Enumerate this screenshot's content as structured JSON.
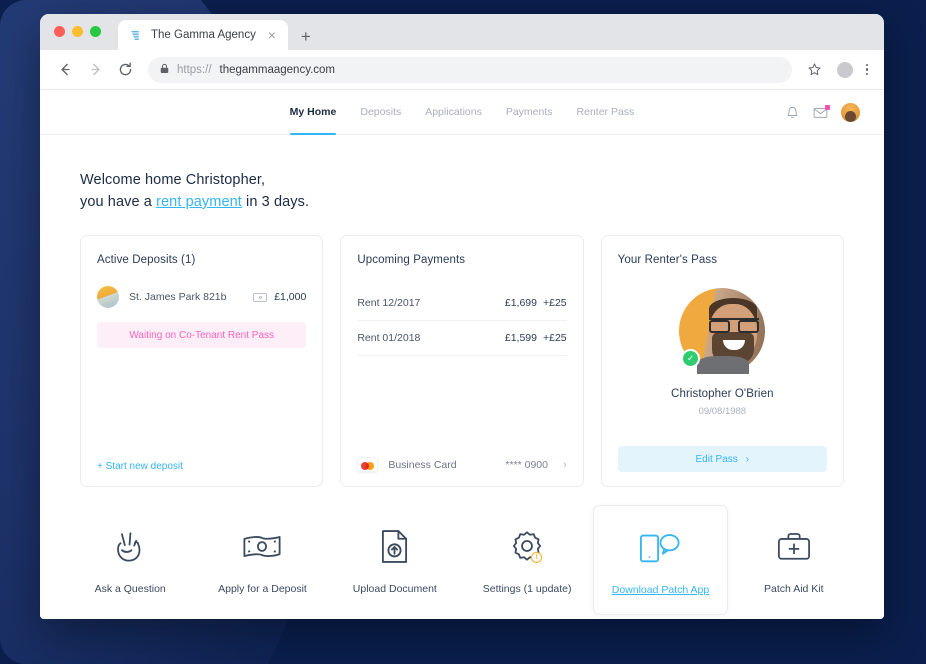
{
  "browser": {
    "tab": {
      "title": "The Gamma Agency",
      "favicon": "gamma-logo-icon",
      "close_label": "×"
    },
    "new_tab_label": "+",
    "back_label": "←",
    "forward_label": "→",
    "reload_label": "⟳",
    "url_scheme": "https://",
    "url_host": "thegammaagency.com",
    "lock_icon": "lock-icon",
    "star_icon": "bookmark-star-icon",
    "menu_icon": "kebab-menu-icon"
  },
  "nav": {
    "items": [
      {
        "label": "My Home",
        "active": true
      },
      {
        "label": "Deposits",
        "active": false
      },
      {
        "label": "Applications",
        "active": false
      },
      {
        "label": "Payments",
        "active": false
      },
      {
        "label": "Renter Pass",
        "active": false
      }
    ],
    "bell_icon": "notification-bell-icon",
    "mail_icon": "mail-envelope-icon",
    "avatar": "user-avatar"
  },
  "welcome": {
    "line1": "Welcome home Christopher,",
    "line2_prefix": "you have a ",
    "line2_link": "rent payment",
    "line2_suffix": " in 3 days."
  },
  "deposits_card": {
    "title": "Active Deposits (1)",
    "row": {
      "thumb": "property-thumbnail",
      "name": "St. James Park 821b",
      "amount": "£1,000",
      "amount_icon": "banknote-icon"
    },
    "status": "Waiting on Co-Tenant Rent Pass",
    "footer_link": "+ Start new deposit"
  },
  "payments_card": {
    "title": "Upcoming Payments",
    "rows": [
      {
        "label": "Rent 12/2017",
        "amount": "£1,699",
        "extra": "+£25"
      },
      {
        "label": "Rent 01/2018",
        "amount": "£1,599",
        "extra": "+£25"
      }
    ],
    "method": {
      "logo": "mastercard-icon",
      "name": "Business Card",
      "number": "**** 0900",
      "chevron": "›"
    }
  },
  "pass_card": {
    "title": "Your Renter's Pass",
    "photo": "renter-photo",
    "verified_icon": "verified-check-icon",
    "name": "Christopher O'Brien",
    "dob": "09/08/1988",
    "button_label": "Edit Pass",
    "button_chevron": "›"
  },
  "actions": [
    {
      "label": "Ask a Question",
      "icon": "peace-hand-icon",
      "highlight": false,
      "link": false
    },
    {
      "label": "Apply for a Deposit",
      "icon": "banknote-icon",
      "highlight": false,
      "link": false
    },
    {
      "label": "Upload Document",
      "icon": "document-upload-icon",
      "highlight": false,
      "link": false
    },
    {
      "label": "Settings (1 update)",
      "icon": "gear-icon",
      "highlight": false,
      "link": false,
      "badge": "!"
    },
    {
      "label": "Download Patch App",
      "icon": "phone-chat-icon",
      "highlight": true,
      "link": true
    },
    {
      "label": "Patch Aid Kit",
      "icon": "first-aid-kit-icon",
      "highlight": false,
      "link": false
    }
  ],
  "colors": {
    "accent_blue": "#34b5f5",
    "pink": "#f564bd",
    "pink_bg": "#fdeef8",
    "navy": "#1d2b44",
    "desktop_bg": "#0a1f4d",
    "green": "#2ecb6f",
    "yellow": "#f5b325"
  }
}
